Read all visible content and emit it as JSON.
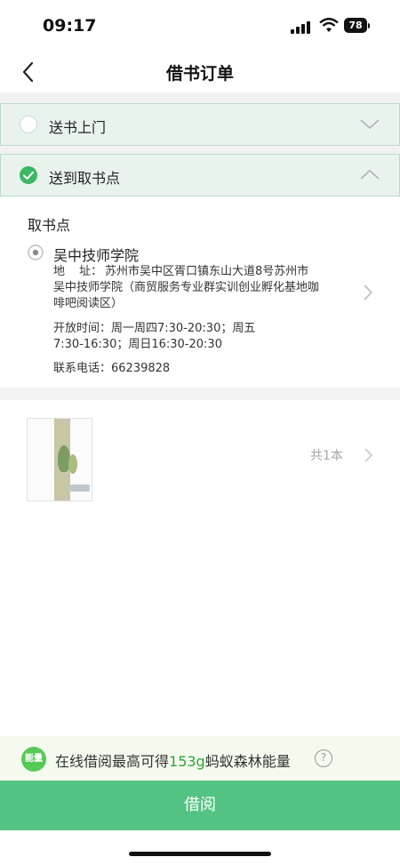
{
  "status_bar": {
    "time": "09:17",
    "battery": "78"
  },
  "header": {
    "title": "借书订单"
  },
  "delivery_options": [
    {
      "label": "送书上门",
      "selected": false
    },
    {
      "label": "送到取书点",
      "selected": true
    }
  ],
  "pickup": {
    "section_title": "取书点",
    "site_name": "吴中技师学院",
    "address_label_1": "地",
    "address_label_2": "址：",
    "address_line_1": "苏州市吴中区胥口镇东山大道8号苏州市",
    "address_line_2": "吴中技师学院（商贸服务专业群实训创业孵化基地咖",
    "address_line_3": "啡吧阅读区）",
    "hours_line_1": "开放时间：周一周四7:30-20:30；周五",
    "hours_line_2": "7:30-16:30；周日16:30-20:30",
    "phone": "联系电话：66239828"
  },
  "books": {
    "count_label": "共1本"
  },
  "energy": {
    "badge": "能量",
    "text_before": "在线借阅最高可得",
    "amount": "153g",
    "text_after": "蚂蚁森林能量",
    "help": "?"
  },
  "footer": {
    "borrow_label": "借阅"
  },
  "colors": {
    "accent": "#53c383",
    "selected_radio": "#3cb764",
    "option_bg": "#e9f3ee",
    "energy_green": "#2da53a"
  }
}
